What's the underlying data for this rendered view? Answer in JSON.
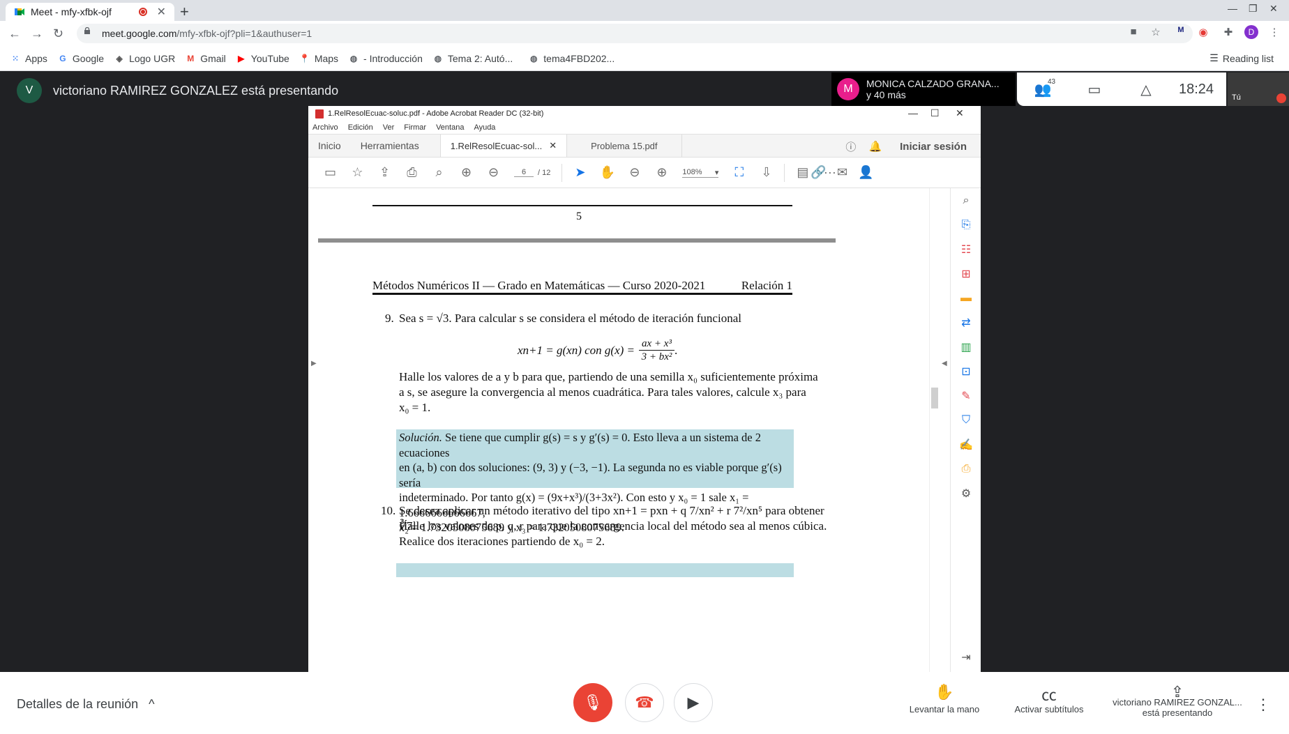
{
  "browser": {
    "tab_title": "Meet - mfy-xfbk-ojf",
    "new_tab": "+",
    "url_domain": "meet.google.com",
    "url_path": "/mfy-xfbk-ojf?pli=1&authuser=1",
    "profile_initial": "D",
    "bookmarks": [
      {
        "label": "Apps",
        "icon": "apps-grid-icon"
      },
      {
        "label": "Google",
        "icon": "google-icon"
      },
      {
        "label": "Logo UGR",
        "icon": "ugr-icon"
      },
      {
        "label": "Gmail",
        "icon": "gmail-icon"
      },
      {
        "label": "YouTube",
        "icon": "youtube-icon"
      },
      {
        "label": "Maps",
        "icon": "maps-icon"
      },
      {
        "label": "- Introducción",
        "icon": "globe-icon"
      },
      {
        "label": "Tema 2: Autó...",
        "icon": "globe-icon"
      },
      {
        "label": "tema4FBD202...",
        "icon": "globe-icon"
      }
    ],
    "reading_list": "Reading list"
  },
  "meet": {
    "presenter_initial": "V",
    "presenter_text": "victoriano RAMIREZ GONZALEZ está presentando",
    "speaker_initial": "M",
    "speaker_name": "MONICA CALZADO GRANA...",
    "speaker_more": "y 40 más",
    "participants_count": "43",
    "time": "18:24",
    "self_label": "Tú",
    "details_label": "Detalles de la reunión",
    "raise_hand": "Levantar la mano",
    "captions": "Activar subtítulos",
    "presenting_line1": "victoriano RAMIREZ GONZAL...",
    "presenting_line2": "está presentando"
  },
  "acrobat": {
    "title": "1.RelResolEcuac-soluc.pdf - Adobe Acrobat Reader DC (32-bit)",
    "menu": [
      "Archivo",
      "Edición",
      "Ver",
      "Firmar",
      "Ventana",
      "Ayuda"
    ],
    "tab_home": "Inicio",
    "tab_tools": "Herramientas",
    "tab_doc1": "1.RelResolEcuac-sol...",
    "tab_doc2": "Problema 15.pdf",
    "signin": "Iniciar sesión",
    "page_current": "6",
    "page_total": "/ 12",
    "zoom": "108%"
  },
  "pdf": {
    "page_number": "5",
    "header_left": "Métodos Numéricos II — Grado en Matemáticas — Curso 2020-2021",
    "header_right": "Relación 1",
    "p9_num": "9.",
    "p9_line1": "Sea s = √3. Para calcular s se considera el método de iteración funcional",
    "p9_formula_left": "xn+1 = g(xn)  con  g(x) =",
    "p9_formula_num": "ax + x³",
    "p9_formula_den": "3 + bx²",
    "p9_body": [
      "Halle los valores de a y b para que, partiendo de una semilla x₀ suficientemente próxima",
      "a s, se asegure la convergencia al menos cuadrática. Para tales valores, calcule x₃ para",
      "x₀ = 1."
    ],
    "sol9_label": "Solución.",
    "sol9": [
      " Se tiene que cumplir g(s) = s y g′(s) = 0. Esto lleva a un sistema de 2 ecuaciones",
      "en (a, b) con dos soluciones: (9, 3) y (−3, −1). La segunda no es viable porque g′(s) sería",
      "indeterminado. Por tanto g(x) = (9x+x³)/(3+3x²). Con esto y x₀ = 1 sale x₁ = 1.6666666666667,",
      "x₂ = 1.7320508075689 y x₃ = 1.7320508075689."
    ],
    "p10_num": "10.",
    "p10": [
      "Se desea aplicar un método iterativo del tipo xn+1 = pxn + q 7/xn² + r 7²/xn⁵ para obtener ∛7.",
      "Halle los valores de p, q, r para que la convergencia local del método sea al menos cúbica.",
      "Realice dos iteraciones partiendo de x₀ = 2."
    ]
  }
}
